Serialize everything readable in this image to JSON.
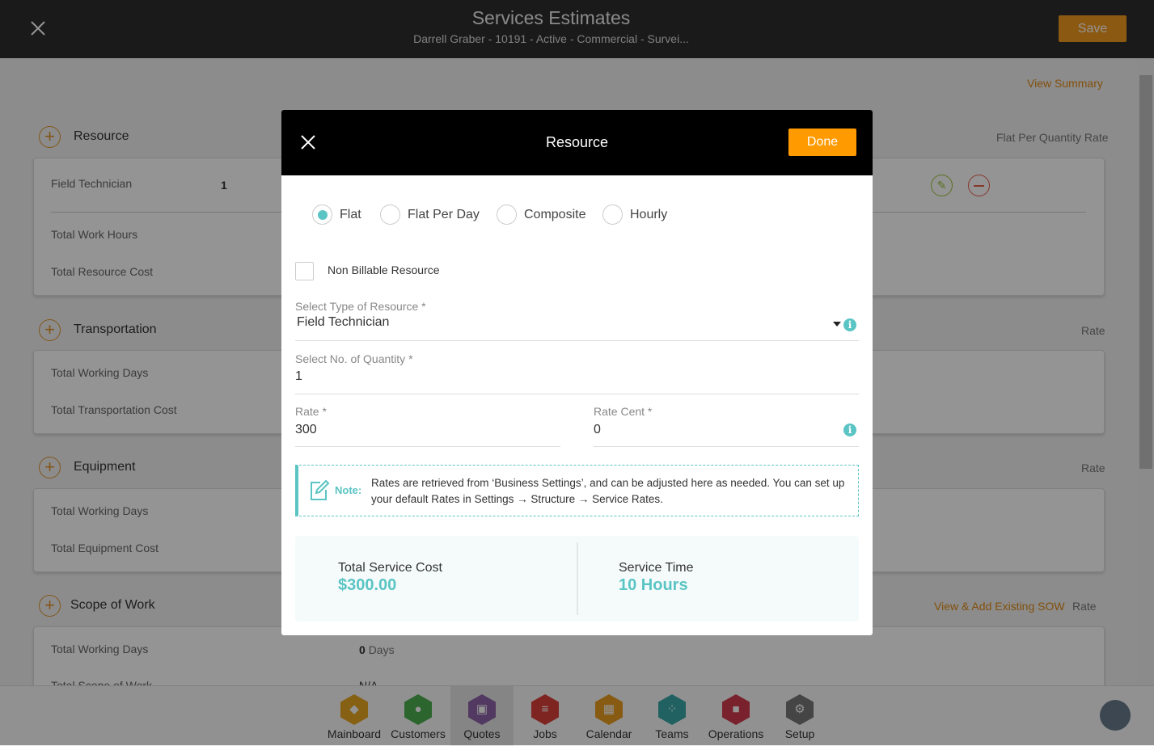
{
  "header": {
    "title": "Services Estimates",
    "subtitle": "Darrell Graber - 10191 - Active - Commercial - Survei...",
    "save_label": "Save"
  },
  "page": {
    "view_summary": "View Summary",
    "sections": [
      {
        "title": "Resource",
        "rate_label": "Flat Per Quantity Rate",
        "rows": [
          {
            "label": "Field Technician",
            "value": "1"
          },
          {
            "label": "Total Work Hours"
          },
          {
            "label": "Total Resource Cost"
          }
        ]
      },
      {
        "title": "Transportation",
        "rate_label": "Rate",
        "rows": [
          {
            "label": "Total Working Days"
          },
          {
            "label": "Total Transportation Cost"
          }
        ]
      },
      {
        "title": "Equipment",
        "rate_label": "Rate",
        "rows": [
          {
            "label": "Total Working Days"
          },
          {
            "label": "Total Equipment Cost"
          }
        ]
      },
      {
        "title": "Scope of Work",
        "rate_label": "Rate",
        "link": "View & Add Existing SOW",
        "rows": [
          {
            "label": "Total Working Days",
            "value": "0",
            "unit": "Days"
          },
          {
            "label": "Total Scope of Work",
            "value": "N/A"
          }
        ]
      }
    ]
  },
  "nav": [
    {
      "label": "Mainboard",
      "color": "#e7a521",
      "icon": "mainboard-icon"
    },
    {
      "label": "Customers",
      "color": "#4caf50",
      "icon": "customers-icon"
    },
    {
      "label": "Quotes",
      "color": "#8e62a8",
      "icon": "quotes-icon",
      "active": true
    },
    {
      "label": "Jobs",
      "color": "#d9403a",
      "icon": "jobs-icon"
    },
    {
      "label": "Calendar",
      "color": "#e89e1f",
      "icon": "calendar-icon"
    },
    {
      "label": "Teams",
      "color": "#3aa8a8",
      "icon": "teams-icon"
    },
    {
      "label": "Operations",
      "color": "#d13c4f",
      "icon": "operations-icon"
    },
    {
      "label": "Setup",
      "color": "#777777",
      "icon": "setup-icon"
    }
  ],
  "modal": {
    "title": "Resource",
    "done_label": "Done",
    "rate_types": [
      "Flat",
      "Flat Per Day",
      "Composite",
      "Hourly"
    ],
    "selected_rate_type": "Flat",
    "non_billable_label": "Non Billable Resource",
    "non_billable_checked": false,
    "type_label": "Select Type of Resource *",
    "type_value": "Field Technician",
    "qty_label": "Select No. of Quantity *",
    "qty_value": "1",
    "rate_label": "Rate *",
    "rate_value": "300",
    "cent_label": "Rate Cent *",
    "cent_value": "0",
    "note_label": "Note:",
    "note_text": "Rates are retrieved from ‘Business Settings’, and can be adjusted here as needed. You can set up your default Rates in Settings → Structure → Service Rates.",
    "total_cost_label": "Total Service Cost",
    "total_cost_value": "$300.00",
    "service_time_label": "Service Time",
    "service_time_value": "10 Hours"
  },
  "colors": {
    "accent": "#5bc4c4",
    "orange": "#ff9a00"
  }
}
